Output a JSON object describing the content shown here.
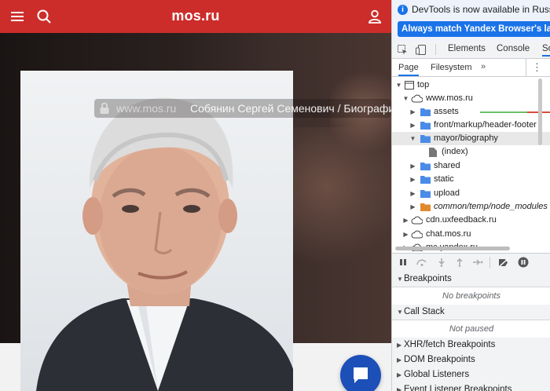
{
  "site": {
    "title": "mos.ru",
    "url_domain": "www.mos.ru",
    "page_title": "Собянин Сергей Семенович / Биография",
    "accent_color": "#cc2d2b",
    "fab_color": "#1d4fb8"
  },
  "devtools": {
    "info_message": "DevTools is now available in Russian!",
    "match_button": "Always match Yandex Browser's language",
    "tabs": [
      "Elements",
      "Console",
      "So"
    ],
    "subtabs": [
      "Page",
      "Filesystem"
    ],
    "more": "»",
    "tree": [
      {
        "label": "top"
      },
      {
        "label": "www.mos.ru"
      },
      {
        "label": "assets"
      },
      {
        "label": "front/markup/header-footer"
      },
      {
        "label": "mayor/biography"
      },
      {
        "label": "(index)"
      },
      {
        "label": "shared"
      },
      {
        "label": "static"
      },
      {
        "label": "upload"
      },
      {
        "label": "common/temp/node_modules"
      },
      {
        "label": "cdn.uxfeedback.ru"
      },
      {
        "label": "chat.mos.ru"
      },
      {
        "label": "mc.yandex.ru"
      }
    ],
    "sections": {
      "breakpoints": "Breakpoints",
      "no_breakpoints": "No breakpoints",
      "call_stack": "Call Stack",
      "not_paused": "Not paused",
      "xhr": "XHR/fetch Breakpoints",
      "dom": "DOM Breakpoints",
      "global": "Global Listeners",
      "event": "Event Listener Breakpoints"
    }
  }
}
